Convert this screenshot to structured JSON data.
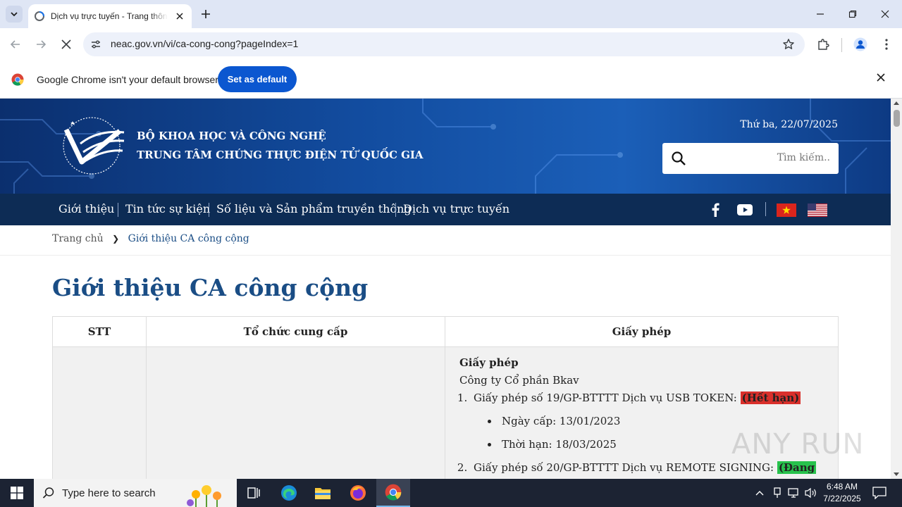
{
  "browser": {
    "tab_title": "Dịch vụ trực tuyến - Trang thông tin",
    "url": "neac.gov.vn/vi/ca-cong-cong?pageIndex=1",
    "infobar_message": "Google Chrome isn't your default browser",
    "set_default_label": "Set as default"
  },
  "site": {
    "org_line1": "BỘ KHOA HỌC VÀ CÔNG NGHỆ",
    "org_line2": "TRUNG TÂM CHỨNG THỰC ĐIỆN TỬ QUỐC GIA",
    "date": "Thứ ba, 22/07/2025",
    "search_placeholder": "Tìm kiếm..",
    "nav": [
      "Giới thiệu",
      "Tin tức sự kiện",
      "Số liệu và Sản phẩm truyền thông",
      "Dịch vụ trực tuyến"
    ]
  },
  "breadcrumb": {
    "home": "Trang chủ",
    "current": "Giới thiệu CA công cộng"
  },
  "page_title": "Giới thiệu CA công cộng",
  "table": {
    "headers": [
      "STT",
      "Tổ chức cung cấp",
      "Giấy phép"
    ],
    "row1": {
      "license_heading": "Giấy phép",
      "company": "Công ty Cổ phần Bkav",
      "items": [
        {
          "text": "Giấy phép số 19/GP-BTTTT Dịch vụ USB TOKEN: ",
          "status": "(Hết hạn)",
          "issued": "Ngày cấp: 13/01/2023",
          "expiry": "Thời hạn: 18/03/2025"
        },
        {
          "text": "Giấy phép số 20/GP-BTTTT Dịch vụ REMOTE SIGNING: ",
          "status": "(Đang"
        }
      ]
    }
  },
  "watermark": "ANY RUN",
  "taskbar": {
    "search_placeholder": "Type here to search",
    "time": "6:48 AM",
    "date": "7/22/2025"
  },
  "colors": {
    "accent": "#0b57d0",
    "site_blue": "#1a4d85",
    "nav_bg": "#0d2c55",
    "expired": "#d9302b",
    "active": "#27c24c"
  }
}
